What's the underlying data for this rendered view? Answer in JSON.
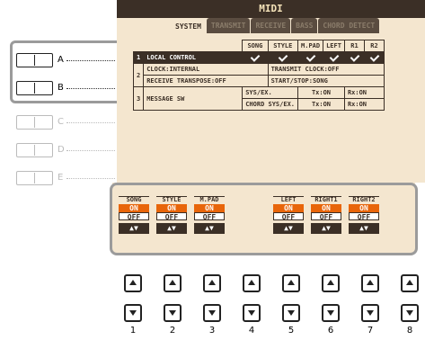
{
  "screen": {
    "title": "MIDI",
    "tabs": [
      "SYSTEM",
      "TRANSMIT",
      "RECEIVE",
      "BASS",
      "CHORD DETECT"
    ],
    "columns": [
      "SONG",
      "STYLE",
      "M.PAD",
      "LEFT",
      "R1",
      "R2"
    ],
    "rows": {
      "r1_num": "1",
      "r1_label": "LOCAL CONTROL",
      "r2_num": "2",
      "r2a_label": "CLOCK:INTERNAL",
      "r2a_right": "TRANSMIT CLOCK:OFF",
      "r2b_label": "RECEIVE TRANSPOSE:OFF",
      "r2b_right": "START/STOP:SONG",
      "r3_num": "3",
      "r3_label": "MESSAGE SW",
      "r3a_a": "SYS/EX.",
      "r3a_b": "Tx:ON",
      "r3a_c": "Rx:ON",
      "r3b_a": "CHORD SYS/EX.",
      "r3b_b": "Tx:ON",
      "r3b_c": "Rx:ON"
    }
  },
  "side_buttons": [
    "A",
    "B",
    "C",
    "D",
    "E"
  ],
  "controls": [
    {
      "name": "SONG",
      "on": "ON",
      "off": "OFF"
    },
    {
      "name": "STYLE",
      "on": "ON",
      "off": "OFF"
    },
    {
      "name": "M.PAD",
      "on": "ON",
      "off": "OFF"
    },
    {
      "name": "LEFT",
      "on": "ON",
      "off": "OFF"
    },
    {
      "name": "RIGHT1",
      "on": "ON",
      "off": "OFF"
    },
    {
      "name": "RIGHT2",
      "on": "ON",
      "off": "OFF"
    }
  ],
  "arrow_glyphs": "▲▼",
  "bottom_numbers": [
    "1",
    "2",
    "3",
    "4",
    "5",
    "6",
    "7",
    "8"
  ]
}
